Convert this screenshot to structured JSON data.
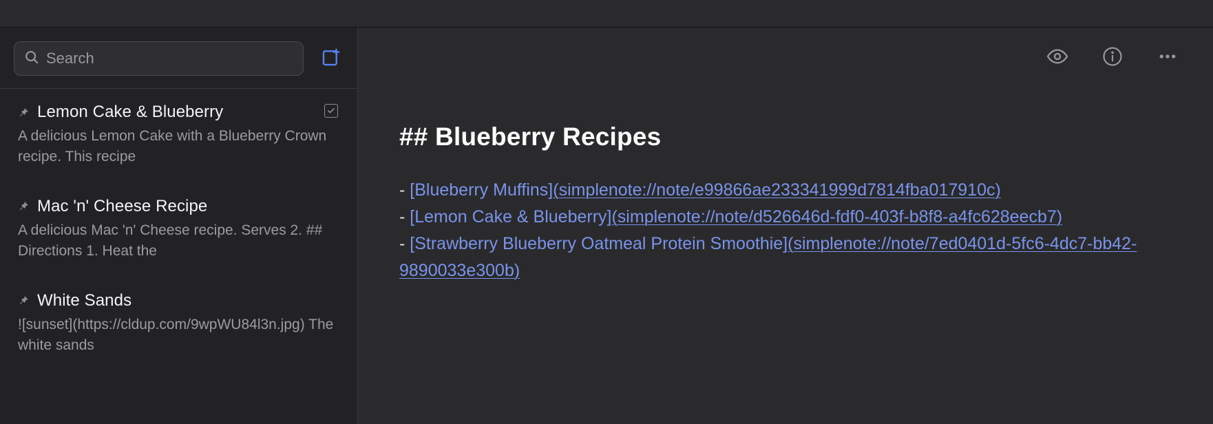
{
  "search": {
    "placeholder": "Search"
  },
  "sidebar": {
    "items": [
      {
        "title": "Lemon Cake & Blueberry",
        "preview": "A delicious Lemon Cake with a Blueberry Crown recipe. This recipe",
        "has_checklist": true
      },
      {
        "title": "Mac 'n' Cheese Recipe",
        "preview": "A delicious Mac 'n' Cheese recipe. Serves 2. ## Directions 1. Heat the",
        "has_checklist": false
      },
      {
        "title": "White Sands",
        "preview": "![sunset](https://cldup.com/9wpWU84l3n.jpg) The white sands",
        "has_checklist": false
      }
    ]
  },
  "editor": {
    "heading_prefix": "## ",
    "heading_text": "Blueberry Recipes",
    "bullet": "- ",
    "links": [
      {
        "label": "[Blueberry Muffins]",
        "url": "(simplenote://note/e99866ae233341999d7814fba017910c)"
      },
      {
        "label": "[Lemon Cake & Blueberry]",
        "url": "(simplenote://note/d526646d-fdf0-403f-b8f8-a4fc628eecb7)"
      },
      {
        "label": "[Strawberry Blueberry Oatmeal Protein Smoothie]",
        "url": "(simplenote://note/7ed0401d-5fc6-4dc7-bb42-9890033e300b)"
      }
    ]
  }
}
